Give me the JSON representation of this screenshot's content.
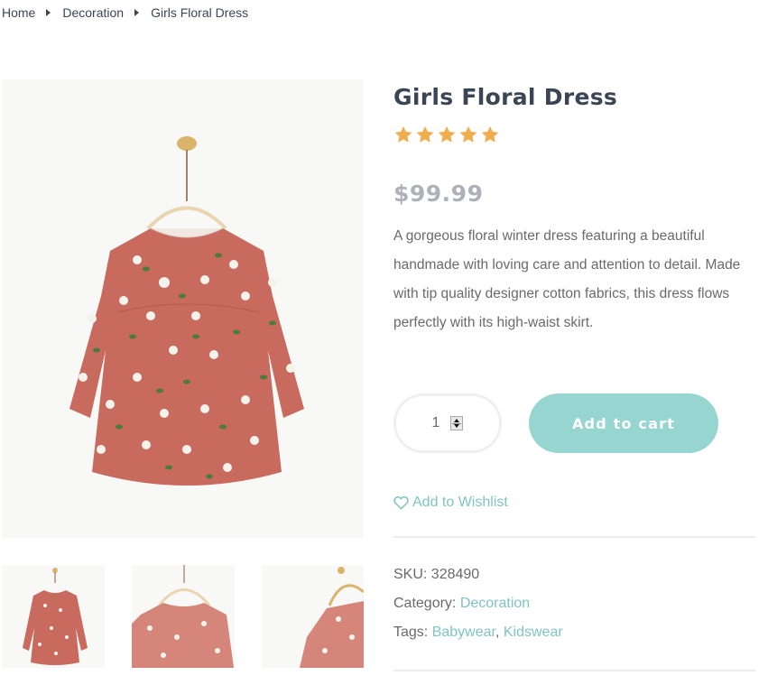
{
  "breadcrumb": {
    "items": [
      "Home",
      "Decoration",
      "Girls Floral Dress"
    ]
  },
  "gallery": {
    "main_image": "floral-dress-front",
    "thumbnails": [
      "floral-dress-front",
      "floral-dress-back-closeup",
      "floral-dress-side"
    ]
  },
  "product": {
    "title": "Girls Floral Dress",
    "rating": 5,
    "rating_max": 5,
    "price": "$99.99",
    "description": "A gorgeous floral winter dress featuring a beautiful handmade with loving care and attention to detail. Made with tip quality designer cotton fabrics, this dress flows perfectly with its high-waist skirt.",
    "quantity": "1",
    "add_to_cart_label": "Add to cart",
    "wishlist_label": "Add to Wishlist",
    "sku_label": "SKU:",
    "sku": "328490",
    "category_label": "Category:",
    "category": "Decoration",
    "tags_label": "Tags:",
    "tags": [
      "Babywear",
      "Kidswear"
    ],
    "tag_separator": ","
  },
  "colors": {
    "accent": "#97d6d0",
    "link": "#7fc5bf",
    "star": "#f0ad4e",
    "title": "#3a4556",
    "price": "#aeb2b8"
  }
}
